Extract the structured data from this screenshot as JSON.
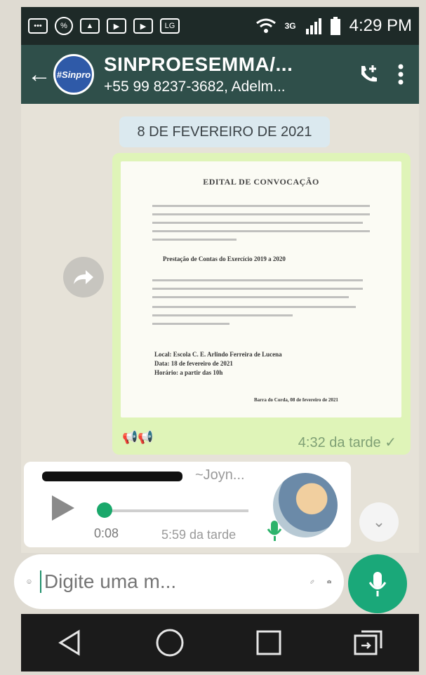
{
  "status_bar": {
    "time": "4:29 PM",
    "network": "3G",
    "icons": [
      "message-icon",
      "percent-icon",
      "image-icon",
      "youtube-icon",
      "youtube-icon",
      "lg-icon",
      "wifi-icon",
      "signal-icon",
      "battery-icon"
    ]
  },
  "header": {
    "title": "SINPROESEMMA/...",
    "subtitle": "+55 99 8237-3682, Adelm...",
    "avatar_text": "#Sinpro"
  },
  "chat": {
    "date_label": "8 DE FEVEREIRO DE 2021",
    "image_message": {
      "doc_title": "EDITAL DE CONVOCAÇÃO",
      "doc_item": "Prestação de Contas do Exercício 2019 a 2020",
      "doc_local": "Local: Escola C. E. Arlindo Ferreira de Lucena",
      "doc_data": "Data: 18 de fevereiro de 2021",
      "doc_horario": "Horário: a partir das 10h",
      "doc_date_sign": "Barra do Corda, 08 de fevereiro de 2021",
      "time": "4:32 da tarde",
      "read_mark": "✓"
    },
    "audio_message": {
      "sender_name": "~Joyn...",
      "duration": "0:08",
      "time": "5:59 da tarde"
    }
  },
  "input": {
    "placeholder": "Digite uma m..."
  },
  "colors": {
    "header": "#2f4f4a",
    "accent": "#1aa879",
    "image_bubble": "#dff4b8"
  }
}
